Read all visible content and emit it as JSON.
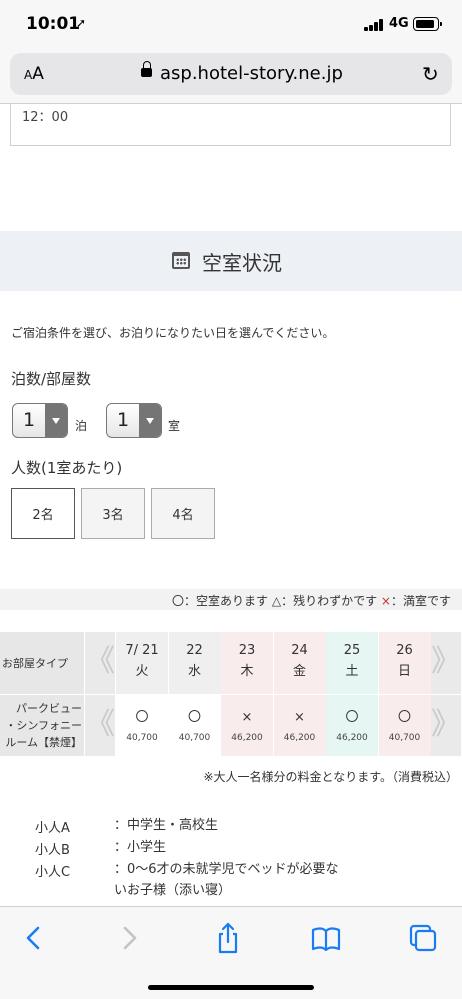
{
  "status_bar": {
    "time": "10:01",
    "network": "4G"
  },
  "browser": {
    "aa_label": "AA",
    "url": "asp.hotel-story.ne.jp"
  },
  "page": {
    "checkin_time": "12：00",
    "section_title": "空室状況",
    "instruction": "ご宿泊条件を選び、お泊りになりたい日を選んでください。",
    "nights_rooms_label": "泊数/部屋数",
    "nights_value": "1",
    "nights_unit": "泊",
    "rooms_value": "1",
    "rooms_unit": "室",
    "persons_label": "人数(1室あたり)",
    "person_options": [
      {
        "label": "2名",
        "selected": true
      },
      {
        "label": "3名",
        "selected": false
      },
      {
        "label": "4名",
        "selected": false
      }
    ],
    "legend": {
      "available": "〇：空室あります",
      "few": "△：残りわずかです",
      "full_mark": "×",
      "full": "：満室です"
    },
    "calendar": {
      "room_type_header": "お部屋タイプ",
      "room_name_lines": [
        "パークビュー",
        "・シンフォニー",
        "ルーム【禁煙】"
      ],
      "prev_icon": "double-chevron-left",
      "next_icon": "double-chevron-right",
      "days": [
        {
          "date": "7/ 21",
          "weekday": "火",
          "status": "〇",
          "price": "40,700",
          "tone": "weekday"
        },
        {
          "date": "22",
          "weekday": "水",
          "status": "〇",
          "price": "40,700",
          "tone": "weekday"
        },
        {
          "date": "23",
          "weekday": "木",
          "status": "×",
          "price": "46,200",
          "tone": "full"
        },
        {
          "date": "24",
          "weekday": "金",
          "status": "×",
          "price": "46,200",
          "tone": "full"
        },
        {
          "date": "25",
          "weekday": "土",
          "status": "〇",
          "price": "46,200",
          "tone": "saturday"
        },
        {
          "date": "26",
          "weekday": "日",
          "status": "〇",
          "price": "40,700",
          "tone": "sunday"
        }
      ]
    },
    "price_note": "※大人一名様分の料金となります。（消費税込）",
    "children": [
      {
        "label": "小人A",
        "desc_lines": [
          "：中学生・高校生"
        ]
      },
      {
        "label": "小人B",
        "desc_lines": [
          "：小学生"
        ]
      },
      {
        "label": "小人C",
        "desc_lines": [
          "：0〜6才の未就学児でベッドが必要な",
          "いお子様（添い寝）"
        ]
      }
    ]
  },
  "colors": {
    "accent_blue": "#1a7cf5",
    "full_red": "#c0392b",
    "saturday_bg": "#e6f6f3",
    "sunday_bg": "#f8ecec"
  },
  "toolbar_icons": [
    "back-icon",
    "forward-icon",
    "share-icon",
    "bookmarks-icon",
    "tabs-icon"
  ]
}
